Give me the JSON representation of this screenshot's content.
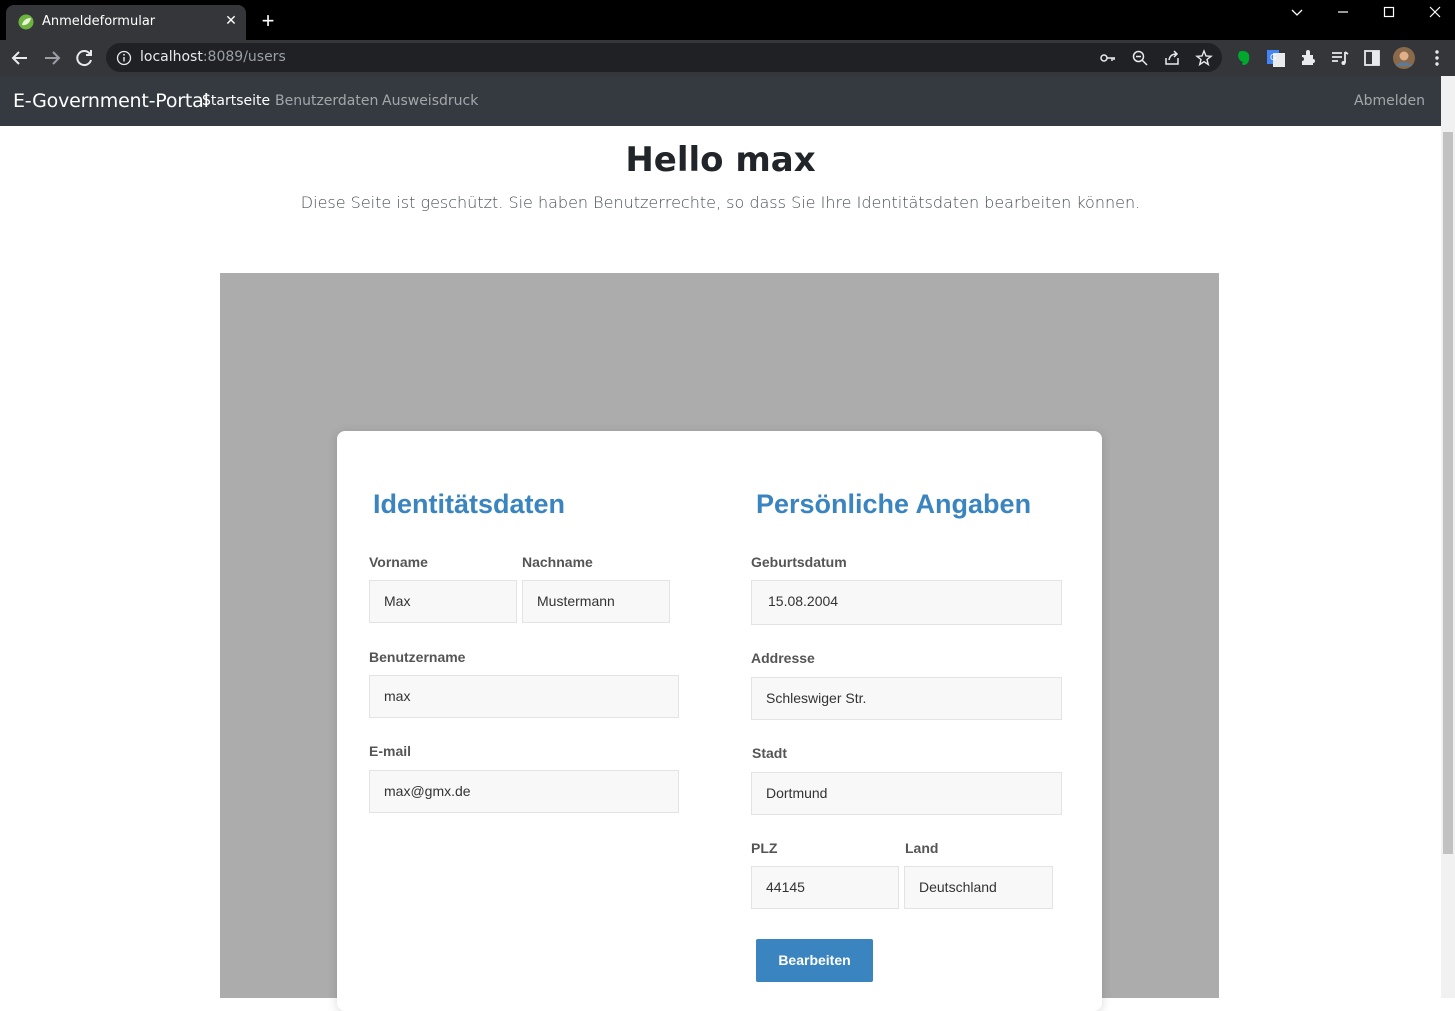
{
  "browser": {
    "tab_title": "Anmeldeformular",
    "url_host": "localhost",
    "url_rest": ":8089/users"
  },
  "navbar": {
    "brand": "E-Government-Portal",
    "links": [
      "Startseite",
      "Benutzerdaten",
      "Ausweisdruck"
    ],
    "logout": "Abmelden"
  },
  "hero": {
    "title": "Hello max",
    "subtitle": "Diese Seite ist geschützt. Sie haben Benutzerrechte, so dass Sie Ihre Identitätsdaten bearbeiten können."
  },
  "identity": {
    "title": "Identitätsdaten",
    "vorname_label": "Vorname",
    "vorname": "Max",
    "nachname_label": "Nachname",
    "nachname": "Mustermann",
    "username_label": "Benutzername",
    "username": "max",
    "email_label": "E-mail",
    "email": "max@gmx.de"
  },
  "personal": {
    "title": "Persönliche Angaben",
    "birth_label": "Geburtsdatum",
    "birth": "15.08.2004",
    "address_label": "Addresse",
    "address": "Schleswiger Str.",
    "city_label": "Stadt",
    "city": "Dortmund",
    "plz_label": "PLZ",
    "plz": "44145",
    "country_label": "Land",
    "country": "Deutschland"
  },
  "submit_label": "Bearbeiten",
  "colors": {
    "accent": "#3a84c0",
    "navbar": "#343a40",
    "panel": "#acacac"
  }
}
